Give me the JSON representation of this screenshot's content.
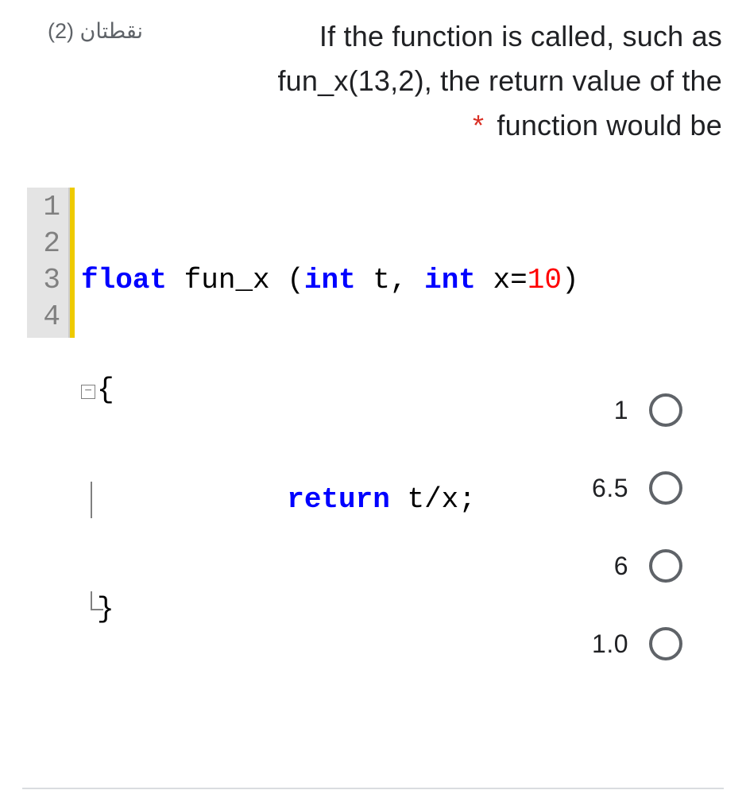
{
  "question": {
    "points_label": "نقطتان (2)",
    "text_line1": "If the function is called, such as",
    "text_line2": "fun_x(13,2), the return value of the",
    "text_line3": "function would be",
    "required_marker": "*"
  },
  "code": {
    "gutter": [
      "1",
      "2",
      "3",
      "4"
    ],
    "line1": {
      "kw1": "float",
      "mid": " fun_x (",
      "kw2": "int",
      "mid2": " t, ",
      "kw3": "int",
      "mid3": " x=",
      "num": "10",
      "end": ")"
    },
    "line2": {
      "brace": "{"
    },
    "line3": {
      "indent": "            ",
      "kw": "return",
      "rest": " t/x;"
    },
    "line4": {
      "brace": "}"
    },
    "fold_glyph": "−"
  },
  "options": [
    {
      "label": "1"
    },
    {
      "label": "6.5"
    },
    {
      "label": "6"
    },
    {
      "label": "1.0"
    }
  ]
}
